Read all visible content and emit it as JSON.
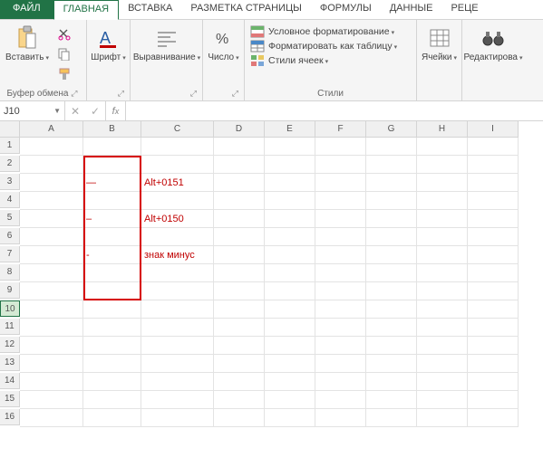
{
  "tabs": {
    "file": "ФАЙЛ",
    "home": "ГЛАВНАЯ",
    "insert": "ВСТАВКА",
    "layout": "РАЗМЕТКА СТРАНИЦЫ",
    "formulas": "ФОРМУЛЫ",
    "data": "ДАННЫЕ",
    "review": "РЕЦЕ"
  },
  "ribbon": {
    "paste": "Вставить",
    "clipboard_group": "Буфер обмена",
    "font": "Шрифт",
    "alignment": "Выравнивание",
    "number": "Число",
    "styles_group": "Стили",
    "cond_fmt": "Условное форматирование",
    "fmt_table": "Форматировать как таблицу",
    "cell_styles": "Стили ячеек",
    "cells": "Ячейки",
    "editing": "Редактирова"
  },
  "fx": {
    "namebox": "J10",
    "formula": ""
  },
  "cols": [
    "A",
    "B",
    "C",
    "D",
    "E",
    "F",
    "G",
    "H",
    "I"
  ],
  "rows": [
    "1",
    "2",
    "3",
    "4",
    "5",
    "6",
    "7",
    "8",
    "9",
    "10",
    "11",
    "12",
    "13",
    "14",
    "15",
    "16"
  ],
  "cells": {
    "B3": "—",
    "C3": "Alt+0151",
    "B5": "–",
    "C5": "Alt+0150",
    "B7": "-",
    "C7": "знак минус"
  },
  "selected_row": "10"
}
